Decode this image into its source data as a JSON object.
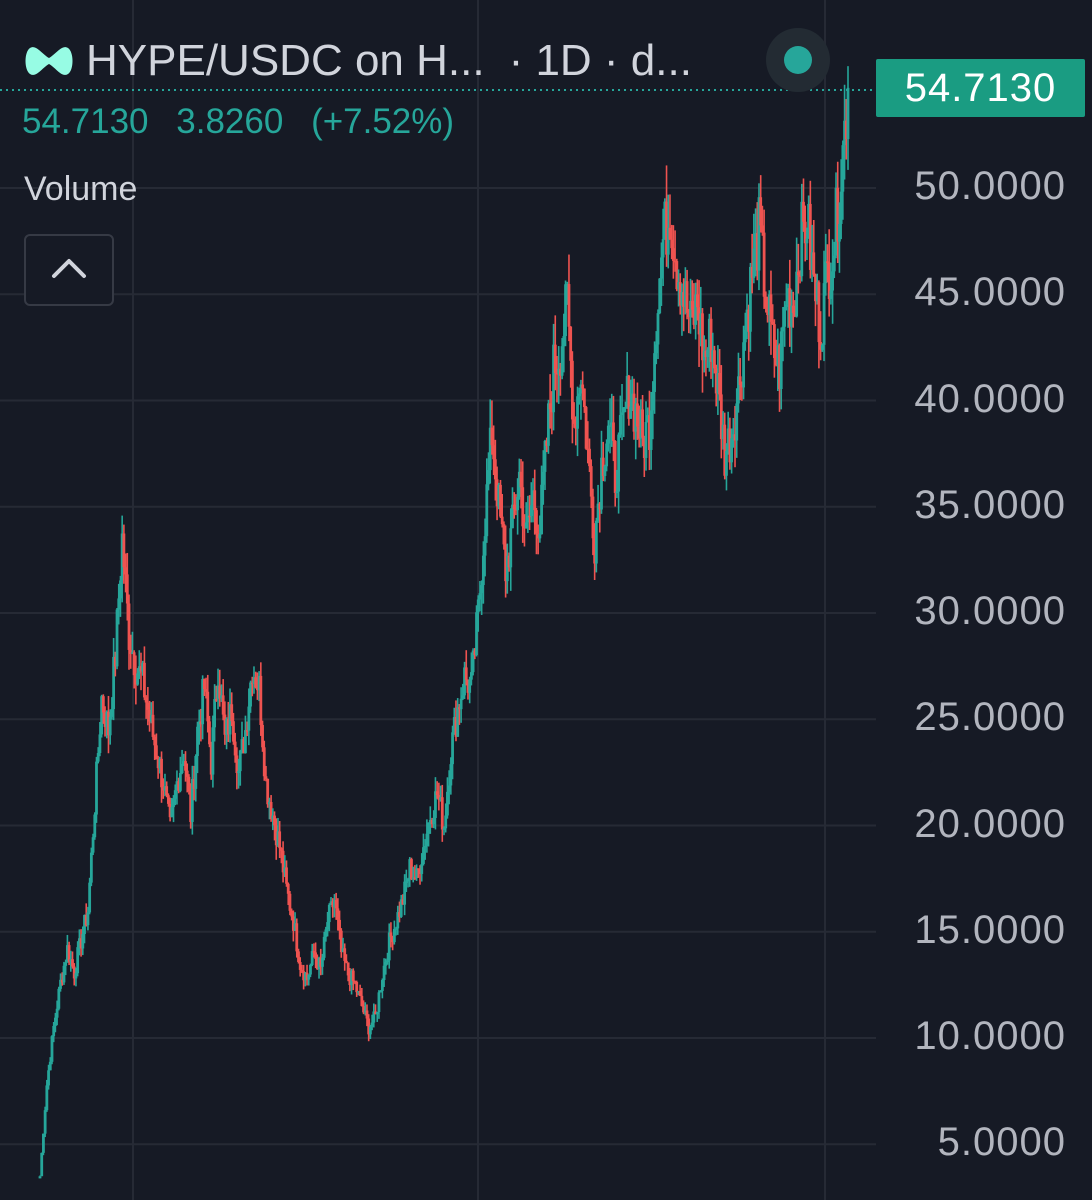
{
  "header": {
    "symbol": "HYPE/USDC on H...",
    "interval": "· 1D · d..."
  },
  "ohlc": {
    "close": "54.7130",
    "change": "3.8260",
    "change_pct": "(+7.52%)"
  },
  "indicator": {
    "label": "Volume"
  },
  "price_axis": {
    "labels": [
      "50.0000",
      "45.0000",
      "40.0000",
      "35.0000",
      "30.0000",
      "25.0000",
      "20.0000",
      "15.0000",
      "10.0000",
      "5.0000"
    ],
    "last_price": "54.7130"
  },
  "colors": {
    "background": "#161a25",
    "up": "#26a69a",
    "down": "#ef5350",
    "grid": "#262a35",
    "last_price_tag": "#1a9c82"
  },
  "icons": {
    "logo": "hyperliquid-logo-icon",
    "collapse": "chevron-up-icon",
    "live": "live-status-dot-icon"
  },
  "chart_data": {
    "type": "candlestick",
    "symbol": "HYPE/USDC",
    "interval": "1D",
    "ylim": [
      3.5,
      60
    ],
    "last_price": 54.713,
    "closes": [
      3.5,
      7.8,
      10.5,
      12.6,
      14.2,
      13.1,
      14.6,
      16.0,
      21.0,
      26.0,
      24.5,
      28.0,
      33.5,
      29.0,
      27.5,
      26.8,
      25.0,
      23.5,
      22.0,
      19.8,
      22.0,
      23.5,
      20.5,
      24.5,
      26.5,
      23.0,
      27.5,
      24.0,
      25.5,
      22.5,
      24.5,
      27.5,
      26.5,
      22.0,
      20.5,
      19.0,
      17.0,
      15.5,
      13.5,
      12.8,
      14.0,
      13.2,
      15.5,
      16.5,
      14.0,
      13.0,
      12.5,
      11.5,
      10.5,
      11.0,
      13.0,
      14.5,
      15.5,
      16.5,
      18.0,
      17.5,
      19.0,
      20.5,
      21.5,
      20.0,
      23.5,
      25.5,
      27.0,
      26.5,
      30.0,
      34.5,
      38.5,
      35.0,
      32.0,
      34.0,
      36.5,
      33.5,
      35.5,
      34.0,
      38.0,
      41.5,
      42.5,
      44.5,
      39.0,
      41.5,
      37.5,
      33.5,
      37.0,
      39.0,
      36.5,
      38.5,
      40.5,
      39.5,
      38.0,
      39.0,
      44.0,
      47.5,
      49.0,
      46.5,
      45.0,
      43.5,
      44.5,
      42.0,
      43.0,
      40.5,
      37.5,
      38.5,
      40.5,
      43.5,
      46.0,
      48.0,
      45.0,
      42.5,
      41.5,
      45.0,
      44.5,
      47.5,
      48.5,
      45.5,
      43.5,
      46.0,
      47.5,
      50.8,
      54.713
    ]
  }
}
